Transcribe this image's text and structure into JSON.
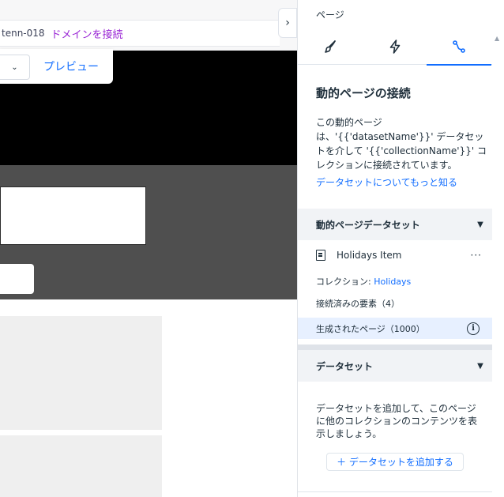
{
  "canvas": {
    "site_name": "tenn-018",
    "connect_domain": "ドメインを接続",
    "collapse_glyph": "›",
    "mode_glyph": "⌄",
    "preview_label": "プレビュー"
  },
  "panel": {
    "label": "ページ",
    "tabs": [
      {
        "icon": "brush-icon",
        "name": "design"
      },
      {
        "icon": "lightning-icon",
        "name": "interactions"
      },
      {
        "icon": "connect-icon",
        "name": "connect",
        "active": true
      }
    ],
    "heading": "動的ページの接続",
    "description": "この動的ページは、'{{'datasetName'}}' データセットを介して '{{'collectionName'}}' コレクションに接続されています。",
    "learn_more": "データセットについてもっと知る",
    "dynamic_section": {
      "title": "動的ページデータセット",
      "dataset_name": "Holidays Item",
      "more_glyph": "···",
      "collection_label": "コレクション: ",
      "collection_name": "Holidays",
      "connected_elements": "接続済みの要素（4）",
      "generated_pages": "生成されたページ（1000）",
      "info_glyph": "i"
    },
    "datasets_section": {
      "title": "データセット",
      "description": "データセットを追加して、このページに他のコレクションのコンテンツを表示しましょう。",
      "add_button": "＋ データセットを追加する"
    },
    "arrow_glyph": "▼",
    "scroll_glyph": "▲"
  },
  "colors": {
    "accent": "#116dff",
    "domain_link": "#9a27d5",
    "highlight_row": "#e7f0ff",
    "section_bg": "#f1f3f6"
  }
}
